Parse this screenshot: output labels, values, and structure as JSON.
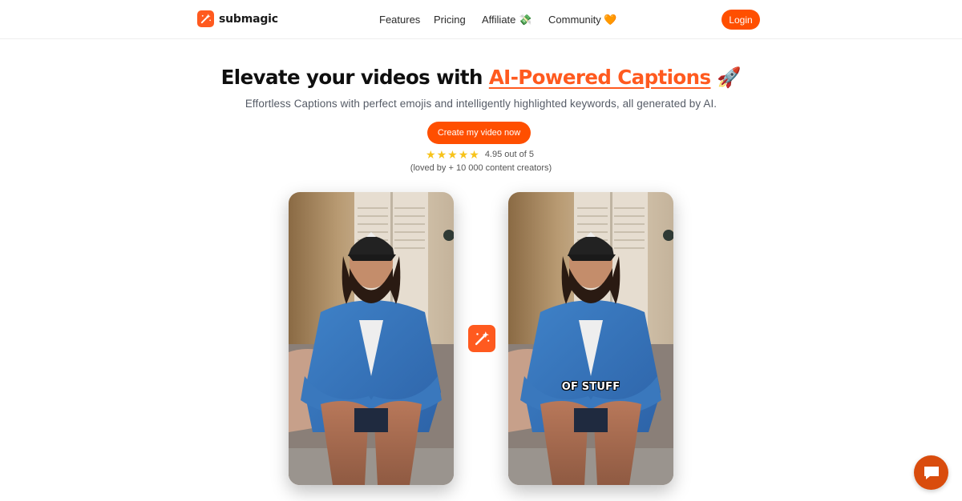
{
  "brand": {
    "name": "submagic",
    "accent": "#ff5a1f",
    "logo_icon": "magic-wand-icon"
  },
  "nav": {
    "features": "Features",
    "pricing": "Pricing",
    "affiliate": "Affiliate 💸",
    "community": "Community 🧡",
    "login": "Login"
  },
  "hero": {
    "headline_prefix": "Elevate your videos with ",
    "headline_highlight": "AI-Powered Captions",
    "headline_suffix": " 🚀",
    "subtitle": "Effortless Captions with perfect emojis and intelligently highlighted keywords, all generated by AI.",
    "cta": "Create my video now",
    "rating_text": "4.95 out of 5",
    "rating_value": 4.95,
    "stars": 5,
    "loved": "(loved by + 10 000 content creators)"
  },
  "demo": {
    "before_label": "",
    "after_caption": "OF STUFF",
    "transform_icon": "magic-wand-icon"
  },
  "chat": {
    "icon": "chat-bubble-icon"
  }
}
